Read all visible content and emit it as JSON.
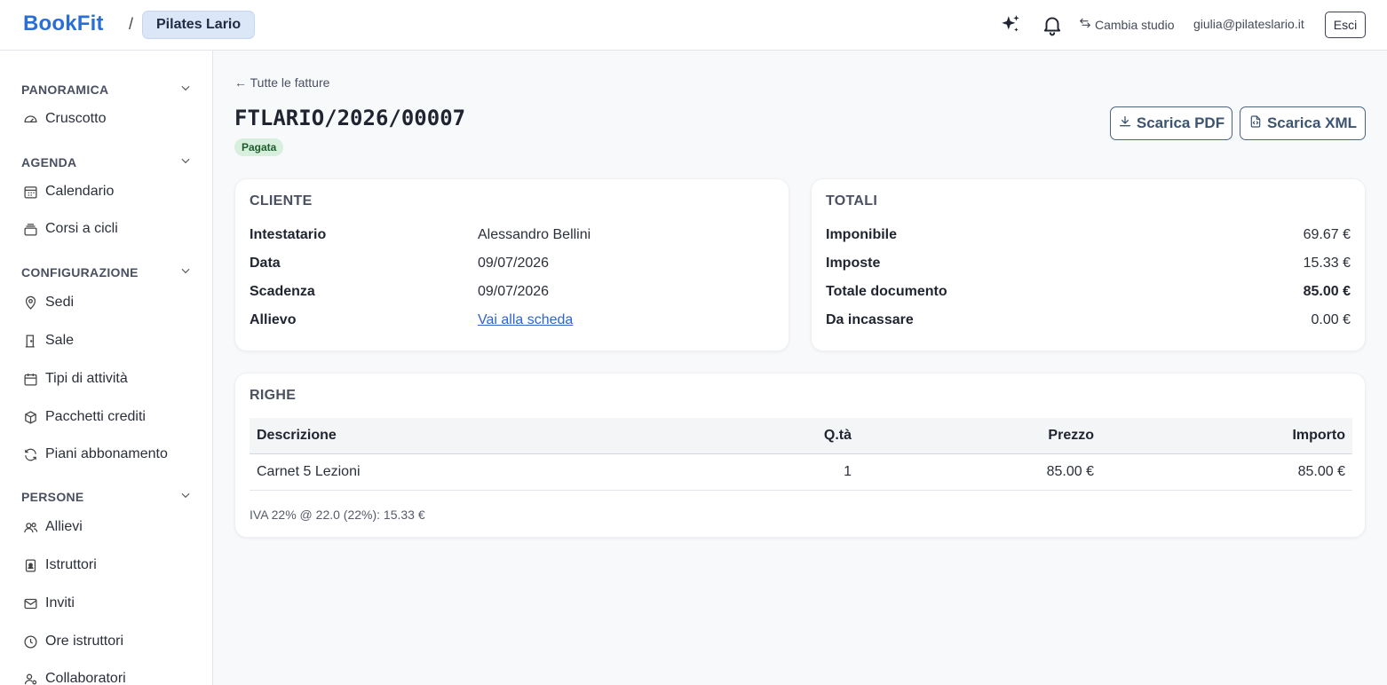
{
  "header": {
    "logo": "BookFit",
    "separator": "/",
    "studio": "Pilates Lario",
    "switch_studio": "Cambia studio",
    "user_email": "giulia@pilateslario.it",
    "logout": "Esci"
  },
  "sidebar": {
    "sections": [
      {
        "title": "PANORAMICA",
        "items": [
          {
            "label": "Cruscotto",
            "icon": "gauge-icon"
          }
        ]
      },
      {
        "title": "AGENDA",
        "items": [
          {
            "label": "Calendario",
            "icon": "calendar-grid-icon"
          },
          {
            "label": "Corsi a cicli",
            "icon": "layers-icon"
          }
        ]
      },
      {
        "title": "CONFIGURAZIONE",
        "items": [
          {
            "label": "Sedi",
            "icon": "map-pin-icon"
          },
          {
            "label": "Sale",
            "icon": "door-icon"
          },
          {
            "label": "Tipi di attività",
            "icon": "calendar-icon"
          },
          {
            "label": "Pacchetti crediti",
            "icon": "package-icon"
          },
          {
            "label": "Piani abbonamento",
            "icon": "refresh-icon"
          }
        ]
      },
      {
        "title": "PERSONE",
        "items": [
          {
            "label": "Allievi",
            "icon": "users-icon"
          },
          {
            "label": "Istruttori",
            "icon": "badge-icon"
          },
          {
            "label": "Inviti",
            "icon": "mail-icon"
          },
          {
            "label": "Ore istruttori",
            "icon": "clock-icon"
          },
          {
            "label": "Collaboratori",
            "icon": "user-cog-icon"
          }
        ]
      }
    ]
  },
  "invoice": {
    "back_link": "← Tutte le fatture",
    "number": "FTLARIO/2026/00007",
    "status": "Pagata",
    "download_pdf": "Scarica PDF",
    "download_xml": "Scarica XML",
    "client": {
      "title": "CLIENTE",
      "rows": [
        {
          "label": "Intestatario",
          "value": "Alessandro Bellini"
        },
        {
          "label": "Data",
          "value": "09/07/2026"
        },
        {
          "label": "Scadenza",
          "value": "09/07/2026"
        },
        {
          "label": "Allievo",
          "value": "Vai alla scheda"
        }
      ]
    },
    "totals": {
      "title": "TOTALI",
      "rows": [
        {
          "label": "Imponibile",
          "value": "69.67 €"
        },
        {
          "label": "Imposte",
          "value": "15.33 €"
        },
        {
          "label": "Totale documento",
          "value": "85.00 €"
        },
        {
          "label": "Da incassare",
          "value": "0.00 €"
        }
      ]
    },
    "lines": {
      "title": "RIGHE",
      "columns": [
        "Descrizione",
        "Q.tà",
        "Prezzo",
        "Importo"
      ],
      "rows": [
        [
          "Carnet 5 Lezioni",
          "1",
          "85.00 €",
          "85.00 €"
        ]
      ],
      "vat_note": "IVA 22% @ 22.0 (22%): 15.33 €"
    }
  },
  "colors": {
    "accent": "#2a6fd6",
    "badge_bg": "#d7efdc",
    "badge_text": "#1d5c2c",
    "link": "#2f64c8"
  }
}
